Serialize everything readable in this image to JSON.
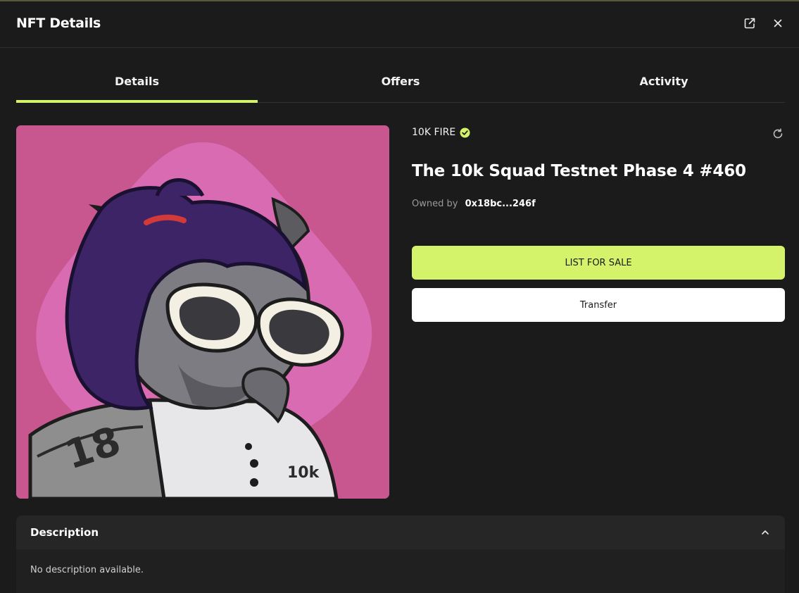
{
  "modal": {
    "title": "NFT Details"
  },
  "tabs": [
    {
      "label": "Details",
      "active": true
    },
    {
      "label": "Offers",
      "active": false
    },
    {
      "label": "Activity",
      "active": false
    }
  ],
  "nft": {
    "collection": "10K FIRE",
    "verified": true,
    "title": "The 10k Squad Testnet Phase 4 #460",
    "owned_by_label": "Owned by",
    "owner_address": "0x18bc...246f",
    "image_badge_number": "18",
    "image_badge_brand": "10k"
  },
  "actions": {
    "list_label": "LIST FOR SALE",
    "transfer_label": "Transfer"
  },
  "description": {
    "title": "Description",
    "body": "No description available."
  },
  "icons": {
    "open_external": "external-link-icon",
    "close": "close-icon",
    "verified": "verified-check-icon",
    "refresh": "refresh-icon",
    "collapse": "chevron-up-icon"
  },
  "colors": {
    "accent": "#d4f36b",
    "background": "#1b1b1b",
    "image_bg": "#c8568f"
  }
}
